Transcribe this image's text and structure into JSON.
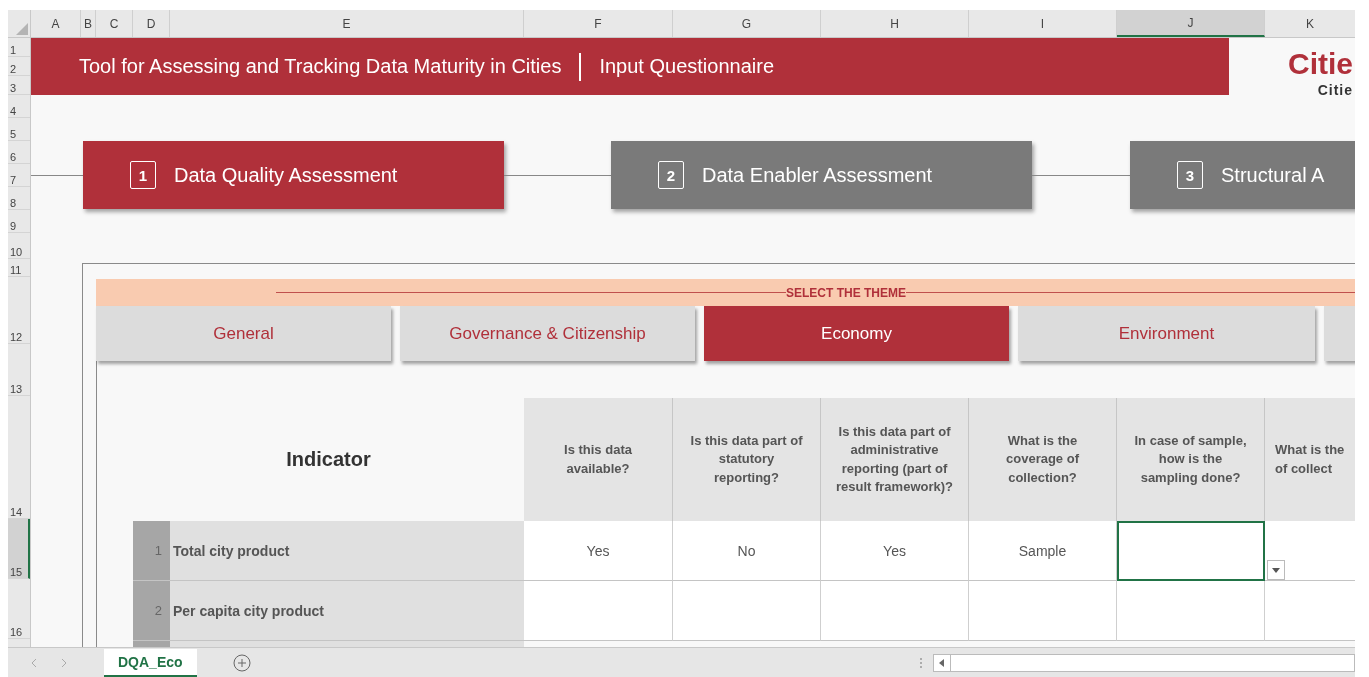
{
  "column_headers": [
    {
      "label": "A",
      "selected": false
    },
    {
      "label": "B",
      "selected": false
    },
    {
      "label": "C",
      "selected": false
    },
    {
      "label": "D",
      "selected": false
    },
    {
      "label": "E",
      "selected": false
    },
    {
      "label": "F",
      "selected": false
    },
    {
      "label": "G",
      "selected": false
    },
    {
      "label": "H",
      "selected": false
    },
    {
      "label": "I",
      "selected": false
    },
    {
      "label": "J",
      "selected": true
    },
    {
      "label": "K",
      "selected": false
    }
  ],
  "row_headers": [
    {
      "label": "1",
      "selected": false
    },
    {
      "label": "2",
      "selected": false
    },
    {
      "label": "3",
      "selected": false
    },
    {
      "label": "4",
      "selected": false
    },
    {
      "label": "5",
      "selected": false
    },
    {
      "label": "6",
      "selected": false
    },
    {
      "label": "7",
      "selected": false
    },
    {
      "label": "8",
      "selected": false
    },
    {
      "label": "9",
      "selected": false
    },
    {
      "label": "10",
      "selected": false
    },
    {
      "label": "11",
      "selected": false
    },
    {
      "label": "12",
      "selected": false
    },
    {
      "label": "13",
      "selected": false
    },
    {
      "label": "14",
      "selected": false
    },
    {
      "label": "15",
      "selected": true
    },
    {
      "label": "16",
      "selected": false
    }
  ],
  "banner": {
    "title": "Tool for Assessing and Tracking Data Maturity in Cities",
    "subtitle": "Input Questionnaire"
  },
  "logo": {
    "name": "Citie",
    "tagline": "Citie"
  },
  "steps": [
    {
      "number": "1",
      "label": "Data Quality Assessment",
      "selected": true
    },
    {
      "number": "2",
      "label": "Data Enabler Assessment",
      "selected": false
    },
    {
      "number": "3",
      "label": "Structural A",
      "selected": false
    }
  ],
  "theme_selector": {
    "title": "SELECT THE THEME",
    "tabs": [
      {
        "label": "General",
        "selected": false
      },
      {
        "label": "Governance & Citizenship",
        "selected": false
      },
      {
        "label": "Economy",
        "selected": true
      },
      {
        "label": "Environment",
        "selected": false
      },
      {
        "selected": false
      }
    ]
  },
  "table": {
    "indicator_heading": "Indicator",
    "columns": [
      "Is this data available?",
      "Is this data part of statutory reporting?",
      "Is this data part of administrative reporting (part of result framework)?",
      "What is the coverage of collection?",
      "In case of sample, how is the sampling done?",
      "What is the\nof collect"
    ],
    "rows": [
      {
        "number": "1",
        "indicator": "Total city product",
        "cells": [
          {
            "text": "Yes",
            "selected": false
          },
          {
            "text": "No",
            "selected": false
          },
          {
            "text": "Yes",
            "selected": false
          },
          {
            "text": "Sample",
            "selected": false
          },
          {
            "selected": true
          },
          {
            "selected": false
          }
        ]
      },
      {
        "number": "2",
        "indicator": "Per capita city product",
        "cells": [
          {
            "selected": false
          },
          {
            "selected": false
          },
          {
            "selected": false
          },
          {
            "selected": false
          },
          {
            "selected": false
          },
          {
            "selected": false
          }
        ]
      }
    ]
  },
  "sheet_tabs": [
    {
      "label": "DQA_Eco",
      "selected": true
    }
  ]
}
